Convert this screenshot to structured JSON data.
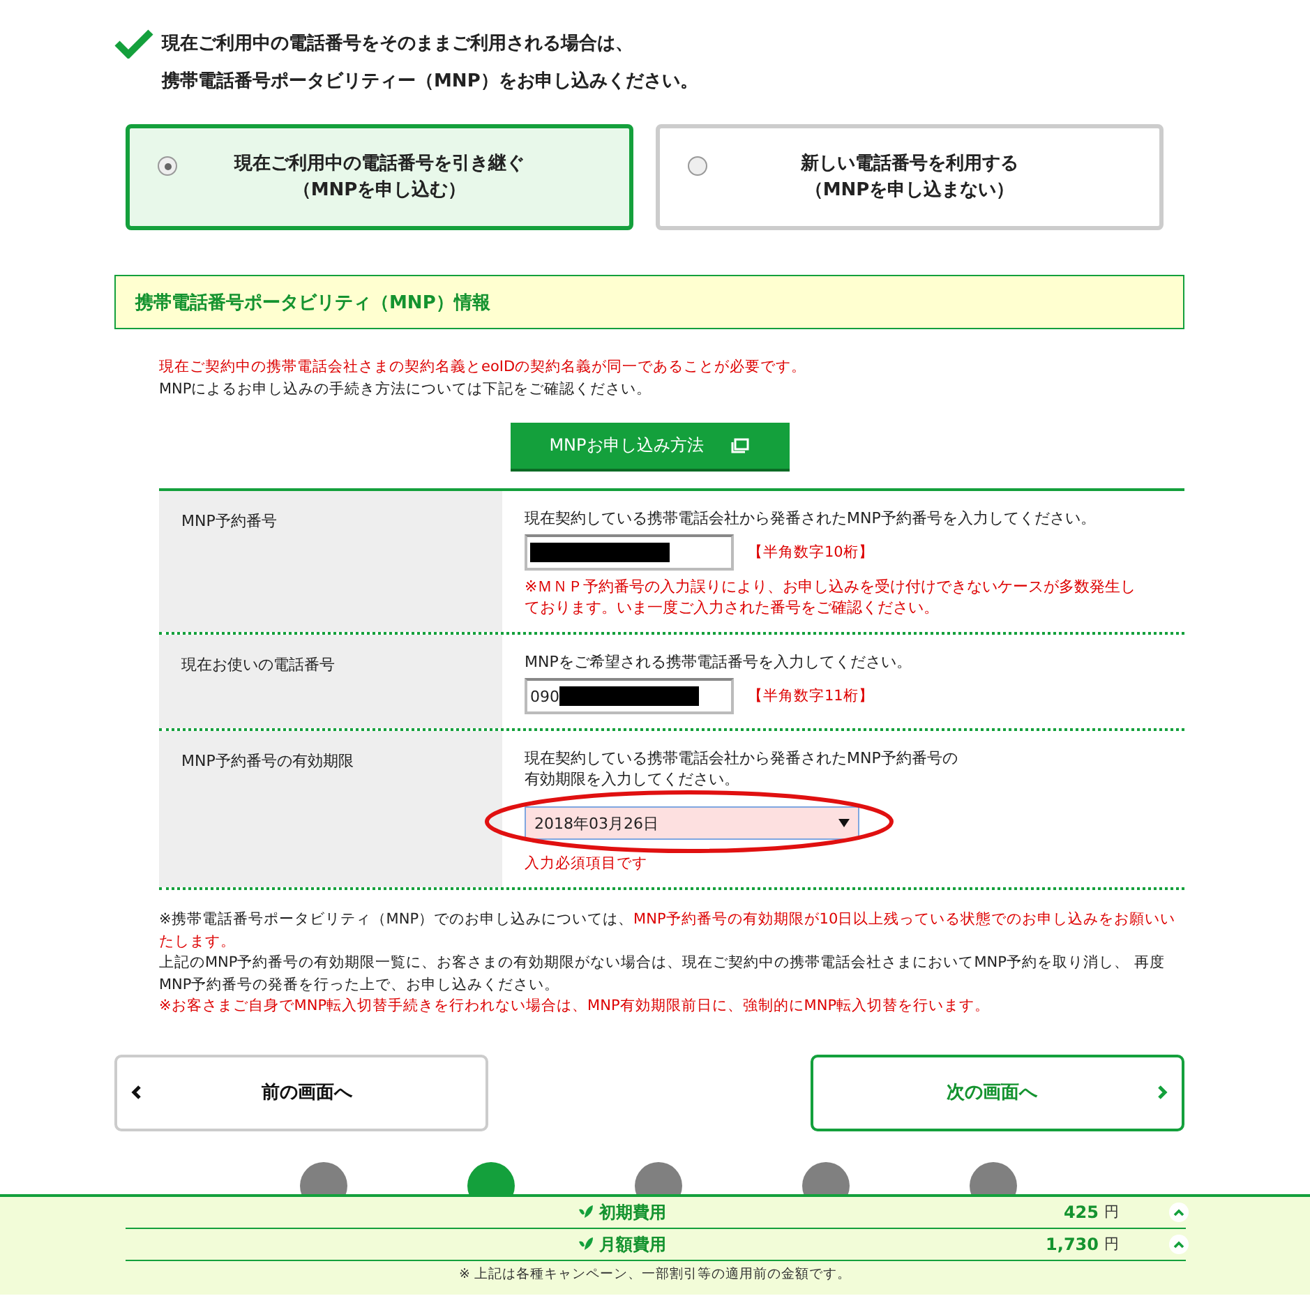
{
  "intro": {
    "lines": [
      "現在ご利用中の電話番号をそのままご利用される場合は、",
      "携帯電話番号ポータビリティー（MNP）をお申し込みください。"
    ]
  },
  "options": [
    {
      "lines": [
        "現在ご利用中の電話番号を引き継ぐ",
        "（MNPを申し込む）"
      ],
      "selected": true
    },
    {
      "lines": [
        "新しい電話番号を利用する",
        "（MNPを申し込まない）"
      ],
      "selected": false
    }
  ],
  "section": {
    "title": "携帯電話番号ポータビリティ（MNP）情報",
    "notes": [
      {
        "text": "現在ご契約中の携帯電話会社さまの契約名義とeoIDの契約名義が同一であることが必要です。",
        "kind": "warning"
      },
      {
        "text": "MNPによるお申し込みの手続き方法については下記をご確認ください。",
        "kind": "normal"
      }
    ],
    "guide_button": "MNPお申し込み方法"
  },
  "form_rows": [
    {
      "label": "MNP予約番号",
      "instruction": "現在契約している携帯電話会社から発番されたMNP予約番号を入力してください。",
      "kind": "text",
      "value": "",
      "redacted": true,
      "hint": "【半角数字10桁】",
      "warning": "※ＭＮＰ予約番号の入力誤りにより、お申し込みを受け付けできないケースが多数発生しております。いま一度ご入力された番号をご確認ください。"
    },
    {
      "label": "現在お使いの電話番号",
      "instruction": "MNPをご希望される携帯電話番号を入力してください。",
      "kind": "text",
      "value": "090",
      "redacted": true,
      "hint": "【半角数字11桁】"
    },
    {
      "label": "MNP予約番号の有効期限",
      "instruction": "現在契約している携帯電話会社から発番されたMNP予約番号の有効期限を入力してください。",
      "kind": "select",
      "value": "2018年03月26日",
      "error": "入力必須項目です",
      "circled": true
    }
  ],
  "footnotes": [
    {
      "parts": [
        {
          "text": "※携帯電話番号ポータビリティ（MNP）でのお申し込みについては、",
          "kind": "normal"
        },
        {
          "text": "MNP予約番号の有効期限が10日以上残っている状態でのお申し込みをお願いいたします。",
          "kind": "warning"
        }
      ]
    },
    {
      "parts": [
        {
          "text": "上記のMNP予約番号の有効期限一覧に、お客さまの有効期限がない場合は、現在ご契約中の携帯電話会社さまにおいてMNP予約を取り消し、 再度MNP予約番号の発番を行った上で、お申し込みください。",
          "kind": "normal"
        }
      ]
    },
    {
      "parts": [
        {
          "text": "※お客さまご自身でMNP転入切替手続きを行われない場合は、MNP有効期限前日に、強制的にMNP転入切替を行います。",
          "kind": "warning"
        }
      ]
    }
  ],
  "nav": {
    "back": "前の画面へ",
    "next": "次の画面へ"
  },
  "steps": [
    {
      "selected": false
    },
    {
      "selected": true
    },
    {
      "selected": false
    },
    {
      "selected": false
    },
    {
      "selected": false
    }
  ],
  "cost_bar": {
    "items": [
      {
        "label": "初期費用",
        "amount": "425",
        "unit": "円"
      },
      {
        "label": "月額費用",
        "amount": "1,730",
        "unit": "円"
      }
    ],
    "note": "※ 上記は各種キャンペーン、一部割引等の適用前の金額です。"
  }
}
